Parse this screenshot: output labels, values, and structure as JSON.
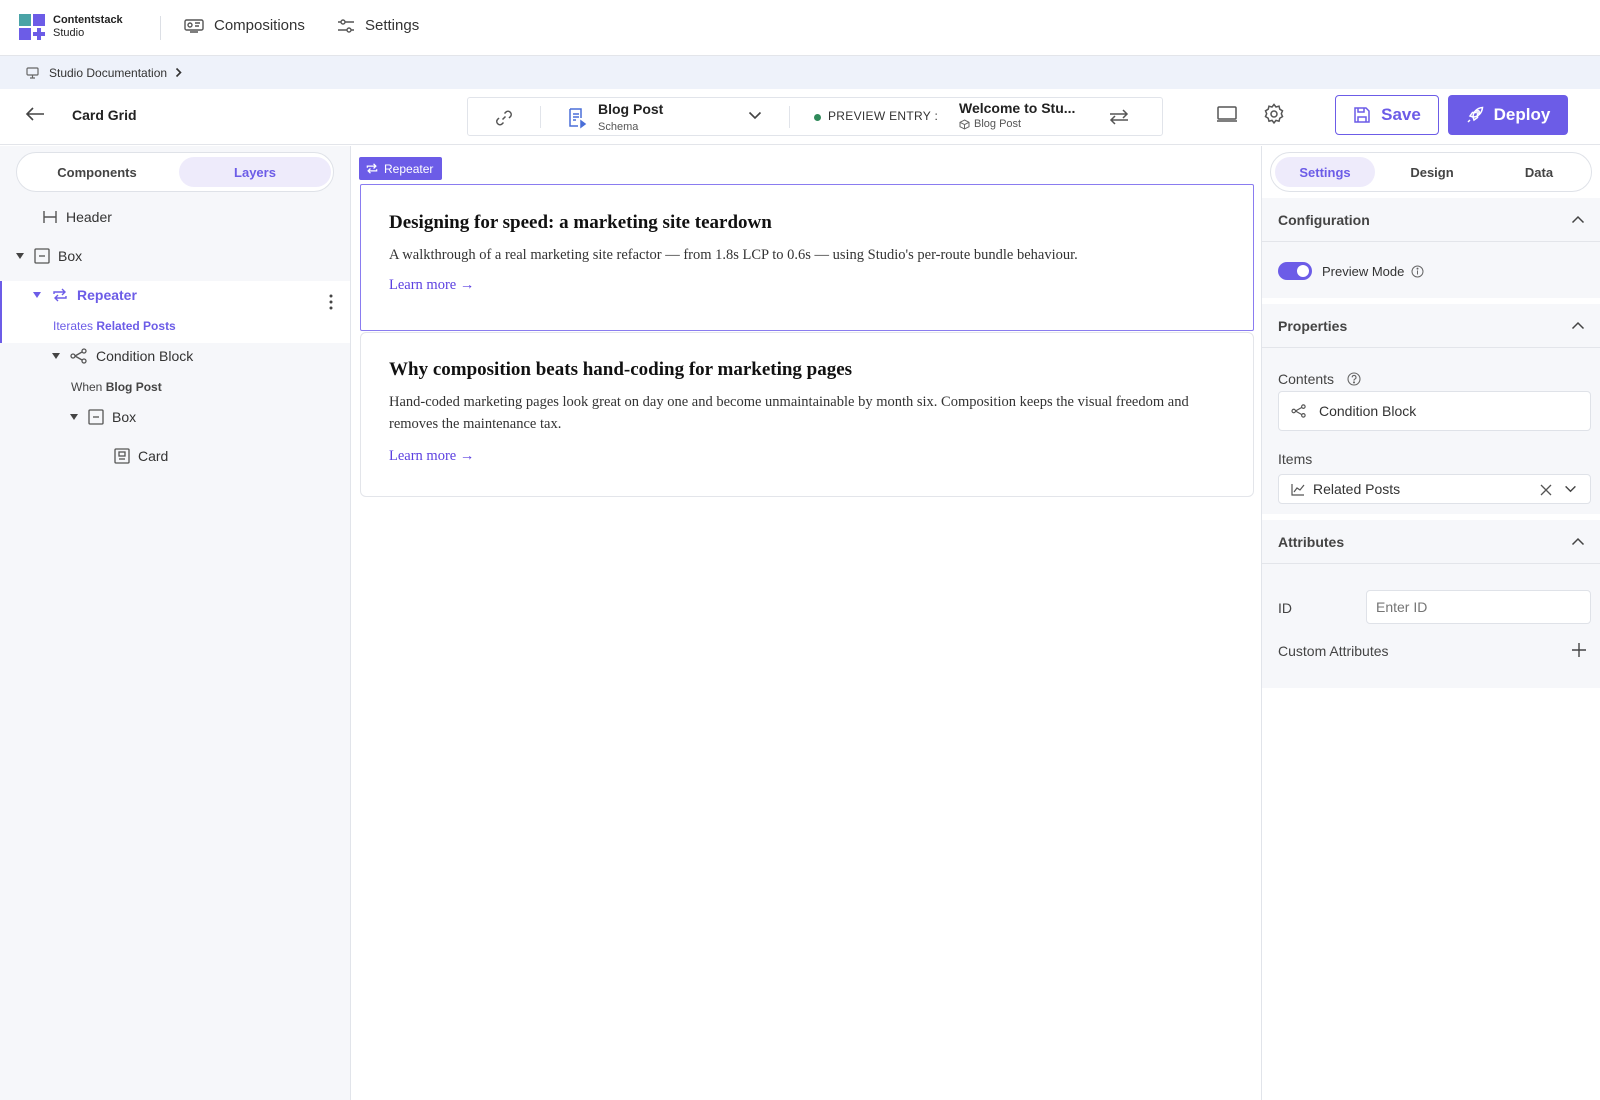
{
  "app": {
    "brand_line1": "Contentstack",
    "brand_line2": "Studio"
  },
  "nav": {
    "compositions": "Compositions",
    "settings": "Settings"
  },
  "breadcrumb": {
    "project": "Studio Documentation"
  },
  "toolbar": {
    "page_name": "Card Grid",
    "schema_title": "Blog Post",
    "schema_sub": "Schema",
    "preview_label": "PREVIEW ENTRY :",
    "entry_title": "Welcome to Stu...",
    "entry_type": "Blog Post",
    "save_label": "Save",
    "deploy_label": "Deploy"
  },
  "left_panel": {
    "tabs": [
      {
        "label": "Components"
      },
      {
        "label": "Layers"
      }
    ],
    "active_tab": "Layers",
    "layers": {
      "header": "Header",
      "box1": "Box",
      "repeater": "Repeater",
      "repeater_sub_prefix": "Iterates",
      "repeater_sub_value": "Related Posts",
      "condition": "Condition Block",
      "condition_sub_prefix": "When",
      "condition_sub_value": "Blog Post",
      "box2": "Box",
      "card": "Card"
    }
  },
  "canvas": {
    "repeater_tag": "Repeater",
    "cards": [
      {
        "title": "Designing for speed: a marketing site teardown",
        "body": "A walkthrough of a real marketing site refactor — from 1.8s LCP to 0.6s — using Studio's per-route bundle behaviour.",
        "link": "Learn more →"
      },
      {
        "title": "Why composition beats hand-coding for marketing pages",
        "body": "Hand-coded marketing pages look great on day one and become unmaintainable by month six. Composition keeps the visual freedom and removes the maintenance tax.",
        "link": "Learn more →"
      }
    ]
  },
  "right_panel": {
    "tabs": [
      {
        "label": "Settings"
      },
      {
        "label": "Design"
      },
      {
        "label": "Data"
      }
    ],
    "active_tab": "Settings",
    "configuration": {
      "title": "Configuration",
      "preview_mode": "Preview Mode",
      "preview_mode_on": true
    },
    "properties": {
      "title": "Properties",
      "contents_label": "Contents",
      "contents_value": "Condition Block",
      "items_label": "Items",
      "items_value": "Related Posts"
    },
    "attributes": {
      "title": "Attributes",
      "id_label": "ID",
      "id_placeholder": "Enter ID",
      "custom_label": "Custom Attributes"
    }
  },
  "colors": {
    "accent": "#6c5ce7",
    "status_dot": "#2f8a5a",
    "selection_bg": "#eeebfb"
  }
}
